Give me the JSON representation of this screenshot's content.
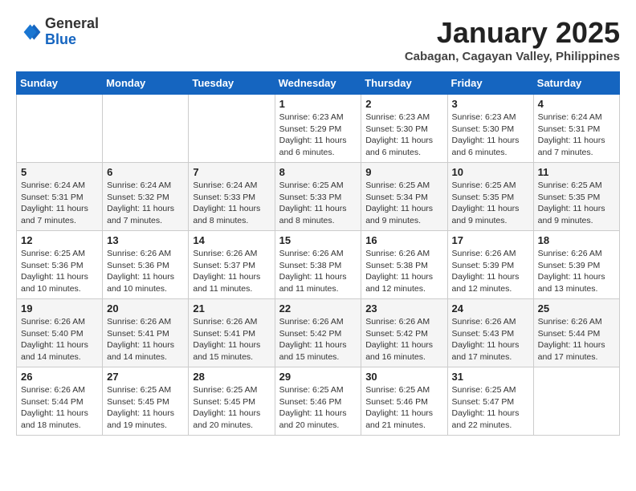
{
  "header": {
    "logo_general": "General",
    "logo_blue": "Blue",
    "month_title": "January 2025",
    "location": "Cabagan, Cagayan Valley, Philippines"
  },
  "days_of_week": [
    "Sunday",
    "Monday",
    "Tuesday",
    "Wednesday",
    "Thursday",
    "Friday",
    "Saturday"
  ],
  "weeks": [
    [
      {
        "day": "",
        "info": ""
      },
      {
        "day": "",
        "info": ""
      },
      {
        "day": "",
        "info": ""
      },
      {
        "day": "1",
        "info": "Sunrise: 6:23 AM\nSunset: 5:29 PM\nDaylight: 11 hours and 6 minutes."
      },
      {
        "day": "2",
        "info": "Sunrise: 6:23 AM\nSunset: 5:30 PM\nDaylight: 11 hours and 6 minutes."
      },
      {
        "day": "3",
        "info": "Sunrise: 6:23 AM\nSunset: 5:30 PM\nDaylight: 11 hours and 6 minutes."
      },
      {
        "day": "4",
        "info": "Sunrise: 6:24 AM\nSunset: 5:31 PM\nDaylight: 11 hours and 7 minutes."
      }
    ],
    [
      {
        "day": "5",
        "info": "Sunrise: 6:24 AM\nSunset: 5:31 PM\nDaylight: 11 hours and 7 minutes."
      },
      {
        "day": "6",
        "info": "Sunrise: 6:24 AM\nSunset: 5:32 PM\nDaylight: 11 hours and 7 minutes."
      },
      {
        "day": "7",
        "info": "Sunrise: 6:24 AM\nSunset: 5:33 PM\nDaylight: 11 hours and 8 minutes."
      },
      {
        "day": "8",
        "info": "Sunrise: 6:25 AM\nSunset: 5:33 PM\nDaylight: 11 hours and 8 minutes."
      },
      {
        "day": "9",
        "info": "Sunrise: 6:25 AM\nSunset: 5:34 PM\nDaylight: 11 hours and 9 minutes."
      },
      {
        "day": "10",
        "info": "Sunrise: 6:25 AM\nSunset: 5:35 PM\nDaylight: 11 hours and 9 minutes."
      },
      {
        "day": "11",
        "info": "Sunrise: 6:25 AM\nSunset: 5:35 PM\nDaylight: 11 hours and 9 minutes."
      }
    ],
    [
      {
        "day": "12",
        "info": "Sunrise: 6:25 AM\nSunset: 5:36 PM\nDaylight: 11 hours and 10 minutes."
      },
      {
        "day": "13",
        "info": "Sunrise: 6:26 AM\nSunset: 5:36 PM\nDaylight: 11 hours and 10 minutes."
      },
      {
        "day": "14",
        "info": "Sunrise: 6:26 AM\nSunset: 5:37 PM\nDaylight: 11 hours and 11 minutes."
      },
      {
        "day": "15",
        "info": "Sunrise: 6:26 AM\nSunset: 5:38 PM\nDaylight: 11 hours and 11 minutes."
      },
      {
        "day": "16",
        "info": "Sunrise: 6:26 AM\nSunset: 5:38 PM\nDaylight: 11 hours and 12 minutes."
      },
      {
        "day": "17",
        "info": "Sunrise: 6:26 AM\nSunset: 5:39 PM\nDaylight: 11 hours and 12 minutes."
      },
      {
        "day": "18",
        "info": "Sunrise: 6:26 AM\nSunset: 5:39 PM\nDaylight: 11 hours and 13 minutes."
      }
    ],
    [
      {
        "day": "19",
        "info": "Sunrise: 6:26 AM\nSunset: 5:40 PM\nDaylight: 11 hours and 14 minutes."
      },
      {
        "day": "20",
        "info": "Sunrise: 6:26 AM\nSunset: 5:41 PM\nDaylight: 11 hours and 14 minutes."
      },
      {
        "day": "21",
        "info": "Sunrise: 6:26 AM\nSunset: 5:41 PM\nDaylight: 11 hours and 15 minutes."
      },
      {
        "day": "22",
        "info": "Sunrise: 6:26 AM\nSunset: 5:42 PM\nDaylight: 11 hours and 15 minutes."
      },
      {
        "day": "23",
        "info": "Sunrise: 6:26 AM\nSunset: 5:42 PM\nDaylight: 11 hours and 16 minutes."
      },
      {
        "day": "24",
        "info": "Sunrise: 6:26 AM\nSunset: 5:43 PM\nDaylight: 11 hours and 17 minutes."
      },
      {
        "day": "25",
        "info": "Sunrise: 6:26 AM\nSunset: 5:44 PM\nDaylight: 11 hours and 17 minutes."
      }
    ],
    [
      {
        "day": "26",
        "info": "Sunrise: 6:26 AM\nSunset: 5:44 PM\nDaylight: 11 hours and 18 minutes."
      },
      {
        "day": "27",
        "info": "Sunrise: 6:25 AM\nSunset: 5:45 PM\nDaylight: 11 hours and 19 minutes."
      },
      {
        "day": "28",
        "info": "Sunrise: 6:25 AM\nSunset: 5:45 PM\nDaylight: 11 hours and 20 minutes."
      },
      {
        "day": "29",
        "info": "Sunrise: 6:25 AM\nSunset: 5:46 PM\nDaylight: 11 hours and 20 minutes."
      },
      {
        "day": "30",
        "info": "Sunrise: 6:25 AM\nSunset: 5:46 PM\nDaylight: 11 hours and 21 minutes."
      },
      {
        "day": "31",
        "info": "Sunrise: 6:25 AM\nSunset: 5:47 PM\nDaylight: 11 hours and 22 minutes."
      },
      {
        "day": "",
        "info": ""
      }
    ]
  ]
}
